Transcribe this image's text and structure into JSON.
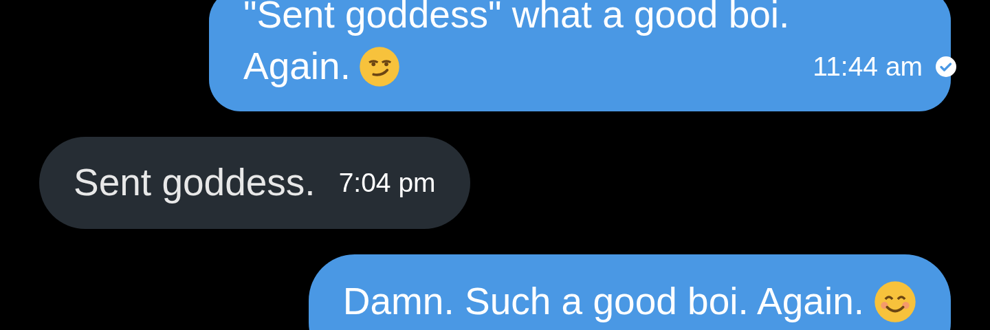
{
  "messages": [
    {
      "kind": "outgoing",
      "lines": [
        "\"Sent goddess\" what a good boi.",
        "Again."
      ],
      "emoji": {
        "kind": "smirking"
      },
      "time": "11:44 am"
    },
    {
      "kind": "incoming",
      "lines": [
        "Sent goddess."
      ],
      "time": "7:04 pm"
    },
    {
      "kind": "outgoing",
      "lines": [
        "Damn. Such a good boi. Again."
      ],
      "emoji": {
        "kind": "smiling"
      }
    }
  ]
}
